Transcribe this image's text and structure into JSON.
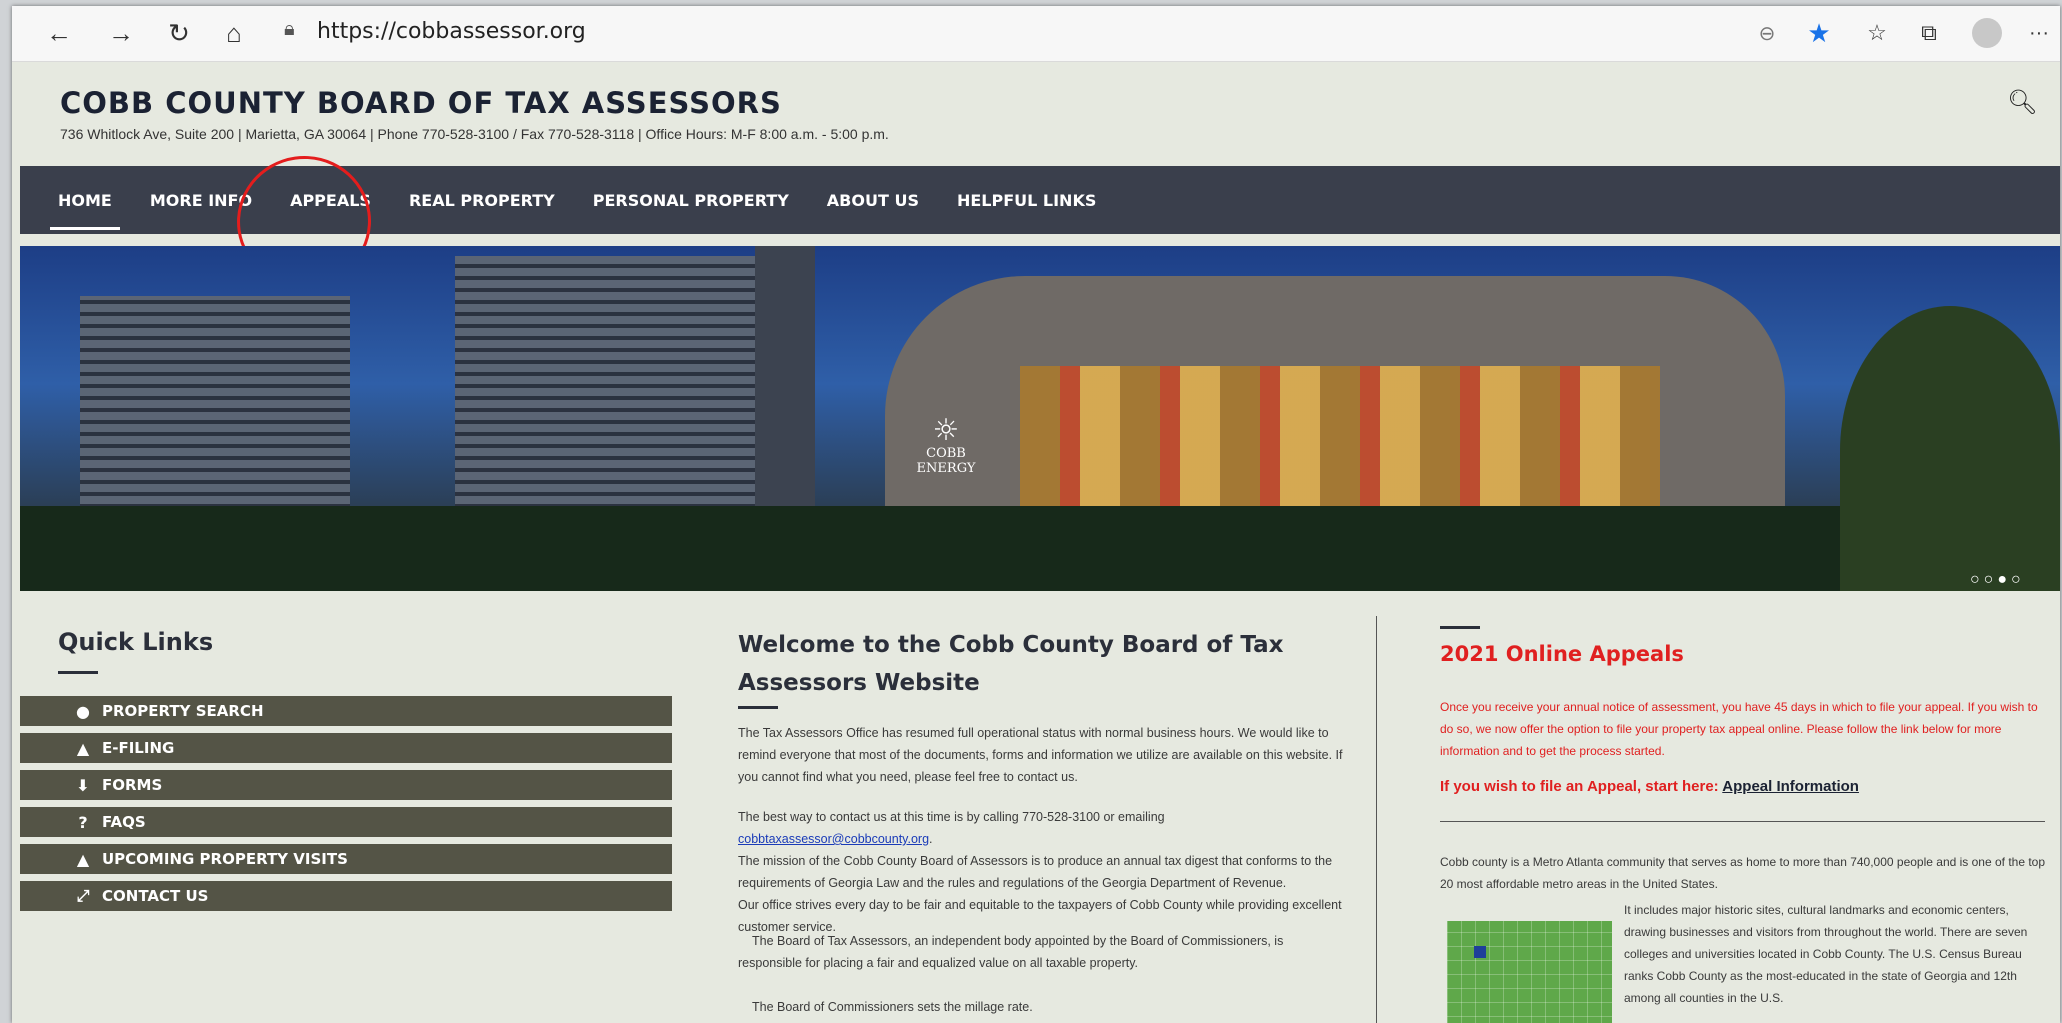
{
  "browser": {
    "url": "https://cobbassessor.org"
  },
  "header": {
    "title": "COBB COUNTY BOARD OF TAX ASSESSORS",
    "subtitle": "736 Whitlock Ave, Suite 200  |  Marietta, GA 30064  |  Phone 770-528-3100 / Fax 770-528-3118  |  Office Hours: M-F 8:00 a.m. - 5:00 p.m."
  },
  "nav": {
    "items": [
      "HOME",
      "MORE INFO",
      "APPEALS",
      "REAL PROPERTY",
      "PERSONAL PROPERTY",
      "ABOUT US",
      "HELPFUL LINKS"
    ]
  },
  "hero": {
    "arena_text": "COBB ENERGY"
  },
  "quick_links": {
    "title": "Quick Links",
    "items": [
      {
        "label": "PROPERTY SEARCH",
        "icon": "user-circle-icon"
      },
      {
        "label": "E-FILING",
        "icon": "chevron-up-icon"
      },
      {
        "label": "FORMS",
        "icon": "download-icon"
      },
      {
        "label": "FAQS",
        "icon": "question-icon"
      },
      {
        "label": "UPCOMING PROPERTY VISITS",
        "icon": "chevron-up-icon"
      },
      {
        "label": "CONTACT US",
        "icon": "expand-icon"
      }
    ]
  },
  "welcome": {
    "title_line1": "Welcome to the Cobb County Board of Tax",
    "title_line2": "Assessors Website",
    "p1": "The Tax Assessors Office has resumed full operational status with normal business hours.  We would like to remind everyone that most of the documents, forms and information we utilize are available on this website. If you cannot find what you need, please feel free to contact us.",
    "p2_before": "The best way to contact us at this time is by calling 770-528-3100 or emailing ",
    "p2_link": "cobbtaxassessor@cobbcounty.org",
    "p2_after": ".",
    "p3": "The mission of the Cobb County Board of Assessors is to produce an annual tax digest that conforms to the requirements of Georgia Law and the rules and regulations of the Georgia Department of Revenue.",
    "p4": "Our office strives every day to be fair and equitable to the taxpayers of Cobb County while providing excellent customer service.",
    "p5": "The Board of Tax Assessors, an independent body appointed by the Board of Commissioners, is responsible for placing a fair and equalized value on all taxable property.",
    "p6": "The Board of Commissioners sets the millage rate."
  },
  "appeals": {
    "title": "2021 Online Appeals",
    "body": "Once you receive your annual notice of assessment, you have 45 days in which to file your appeal. If you wish to do so, we now offer the option to file your property tax appeal online. Please follow the link below for more information and to get the process started.",
    "cta_prefix": "If you wish to file an Appeal, start here: ",
    "cta_link": "Appeal Information"
  },
  "about": {
    "p1": "Cobb county is a Metro Atlanta community that serves as home to more than 740,000 people and is one of the top 20 most affordable metro areas in the United States.",
    "p2": "It includes major historic sites, cultural landmarks and economic centers, drawing businesses and visitors from throughout the world. There are seven colleges and universities located in Cobb County. The U.S. Census Bureau ranks Cobb County as the most-educated in the state of Georgia and 12th among all counties in the U.S."
  }
}
